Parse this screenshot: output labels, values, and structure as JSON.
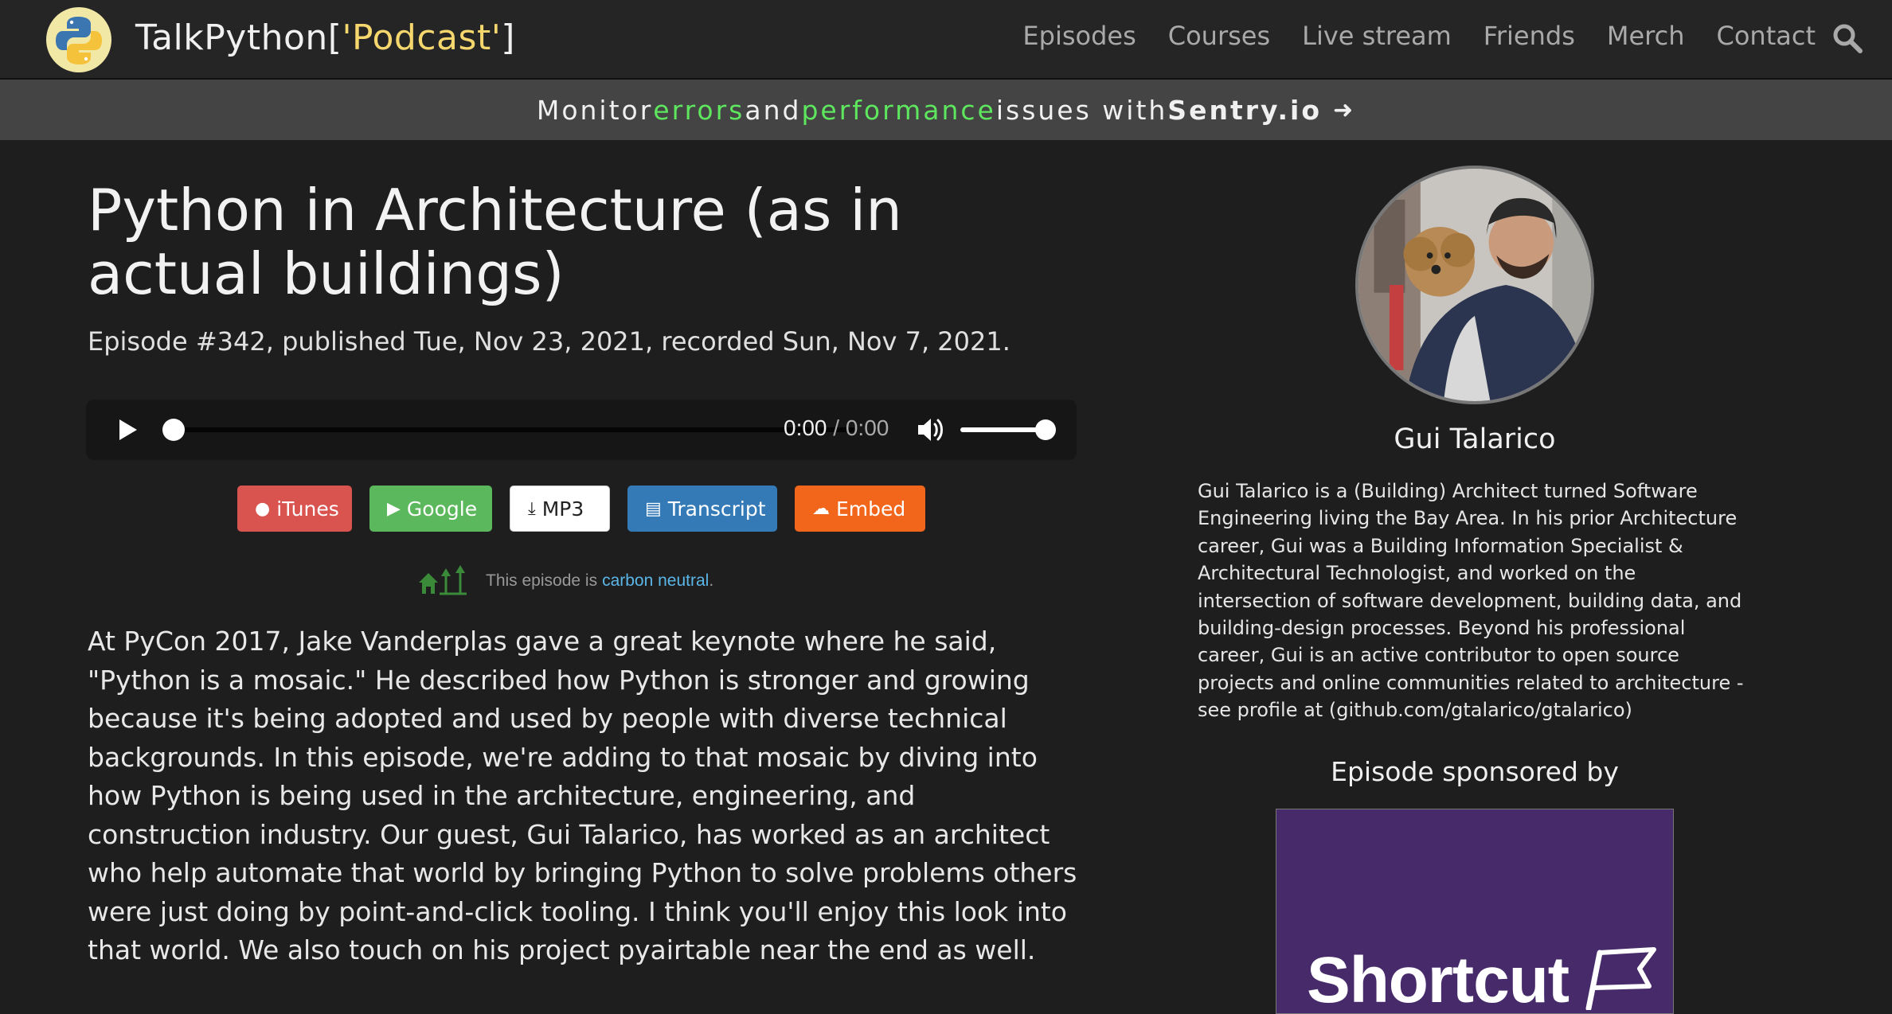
{
  "nav": {
    "brand_prefix": "TalkPython[",
    "brand_quoted": "'Podcast'",
    "brand_suffix": "]",
    "links": [
      "Episodes",
      "Courses",
      "Live stream",
      "Friends",
      "Merch",
      "Contact"
    ],
    "search_icon": "search-icon"
  },
  "sponsor_bar": {
    "t1": "Monitor ",
    "t2": "errors",
    "t3": " and ",
    "t4": "performance",
    "t5": " issues with ",
    "t6": "Sentry.io",
    "arrow": "➜",
    "highlight_color": "#5ee65e"
  },
  "episode": {
    "title": "Python in Architecture (as in actual buildings)",
    "meta": "Episode #342, published Tue, Nov 23, 2021, recorded Sun, Nov 7, 2021.",
    "player": {
      "current": "0:00",
      "duration": " / 0:00",
      "progress": 0,
      "volume": 1
    },
    "buttons": [
      {
        "label": "iTunes",
        "icon": "apple-icon",
        "glyph": "",
        "color": "#d9534f"
      },
      {
        "label": "Google",
        "icon": "play-store-icon",
        "glyph": "▶",
        "color": "#5cb85c"
      },
      {
        "label": "MP3",
        "icon": "download-icon",
        "glyph": "⤓",
        "color": "#ffffff"
      },
      {
        "label": "Transcript",
        "icon": "document-icon",
        "glyph": "▤",
        "color": "#337ab7"
      },
      {
        "label": "Embed",
        "icon": "soundcloud-icon",
        "glyph": "☁",
        "color": "#f2661c"
      }
    ],
    "carbon_text": "This episode is",
    "carbon_link": "carbon neutral",
    "carbon_end": ".",
    "description": "At PyCon 2017, Jake Vanderplas gave a great keynote where he said, \"Python is a mosaic.\" He described how Python is stronger and growing because it's being adopted and used by people with diverse technical backgrounds. In this episode, we're adding to that mosaic by diving into how Python is being used in the architecture, engineering, and construction industry. Our guest, Gui Talarico, has worked as an architect who help automate that world by bringing Python to solve problems others were just doing by point-and-click tooling. I think you'll enjoy this look into that world. We also touch on his project pyairtable near the end as well."
  },
  "guest": {
    "name": "Gui Talarico",
    "bio": "Gui Talarico is a (Building) Architect turned Software Engineering living the Bay Area. In his prior Architecture career, Gui was a Building Information Specialist & Architectural Technologist, and worked on the intersection of software development, building data, and building-design processes. Beyond his professional career, Gui is an active contributor to open source projects and online communities related to architecture - see profile at (github.com/gtalarico/gtalarico)"
  },
  "sponsor": {
    "heading": "Episode sponsored by",
    "name": "Shortcut",
    "bg_color": "#472a6a"
  }
}
